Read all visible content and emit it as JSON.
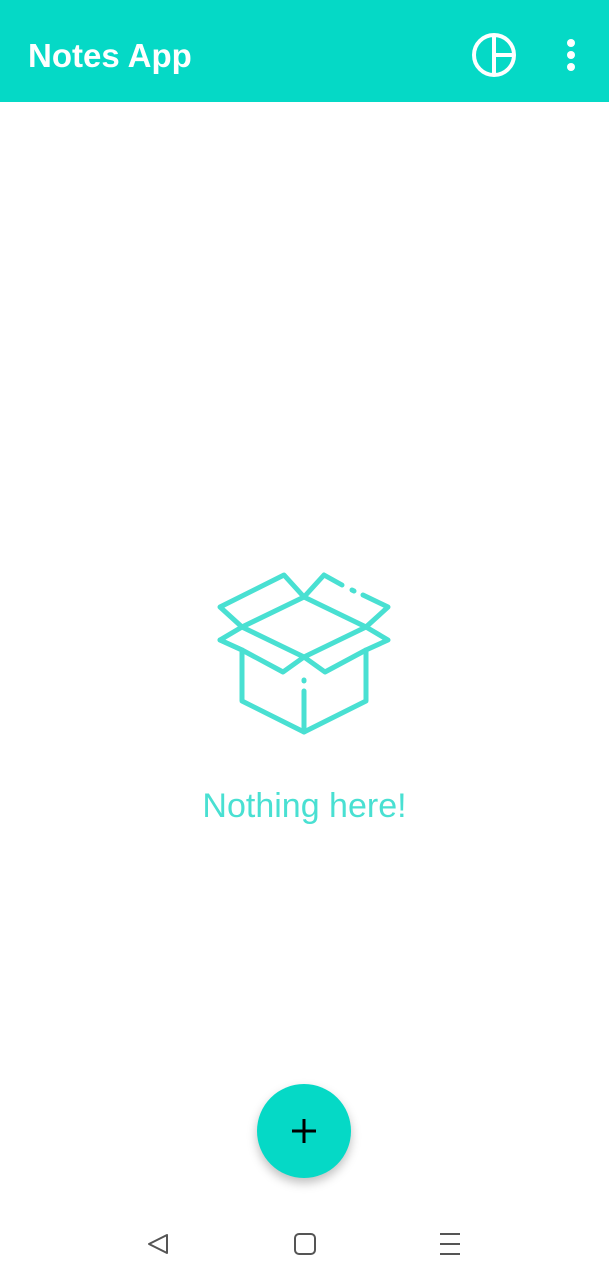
{
  "app_bar": {
    "title": "Notes App",
    "actions": [
      {
        "icon": "pie-chart-icon"
      },
      {
        "icon": "more-vert-icon"
      }
    ]
  },
  "empty_state": {
    "icon": "open-box-icon",
    "message": "Nothing here!"
  },
  "fab": {
    "icon": "plus-icon"
  },
  "system_nav": {
    "buttons": [
      {
        "icon": "back-triangle-icon"
      },
      {
        "icon": "home-square-icon"
      },
      {
        "icon": "recents-menu-icon"
      }
    ]
  },
  "colors": {
    "primary": "#05d9c6",
    "empty_accent": "#49e0d2",
    "on_primary": "#ffffff",
    "fab_icon": "#000000",
    "nav_icon": "#555555"
  }
}
